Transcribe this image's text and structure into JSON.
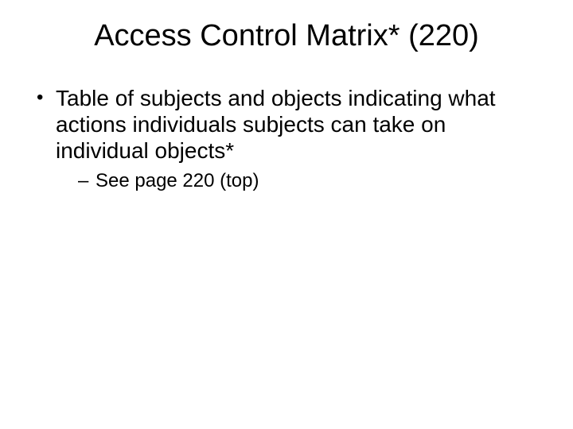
{
  "slide": {
    "title": "Access Control Matrix* (220)",
    "bullets": [
      {
        "text": "Table of subjects and objects indicating what actions individuals subjects can take on individual objects*",
        "sub": [
          "See page 220 (top)"
        ]
      }
    ]
  }
}
